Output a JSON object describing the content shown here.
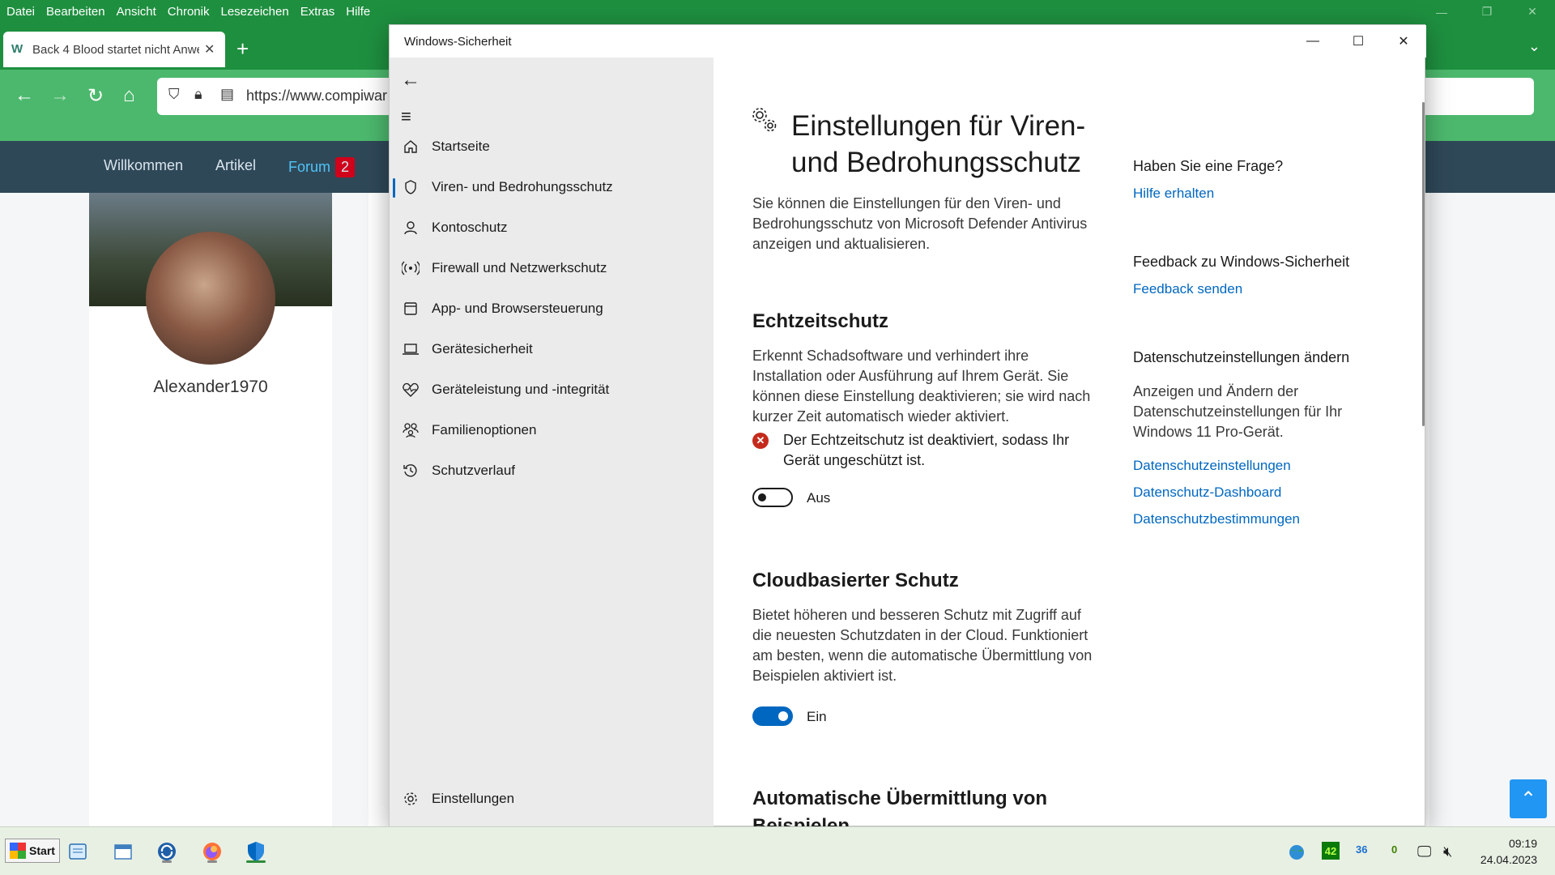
{
  "browser": {
    "menu": [
      "Datei",
      "Bearbeiten",
      "Ansicht",
      "Chronik",
      "Lesezeichen",
      "Extras",
      "Hilfe"
    ],
    "tab_title": "Back 4 Blood startet nicht Anwe",
    "url": "https://www.compiwar"
  },
  "site": {
    "nav": [
      "Willkommen",
      "Artikel",
      "Forum"
    ],
    "forum_badge": "2",
    "username": "Alexander1970"
  },
  "dialog": {
    "title": "Windows-Sicherheit",
    "sidebar": [
      {
        "label": "Startseite",
        "icon": "home-icon"
      },
      {
        "label": "Viren- und Bedrohungsschutz",
        "icon": "shield-icon"
      },
      {
        "label": "Kontoschutz",
        "icon": "person-icon"
      },
      {
        "label": "Firewall und Netzwerkschutz",
        "icon": "wireless-icon"
      },
      {
        "label": "App- und Browsersteuerung",
        "icon": "app-window-icon"
      },
      {
        "label": "Gerätesicherheit",
        "icon": "laptop-icon"
      },
      {
        "label": "Geräteleistung und -integrität",
        "icon": "heart-pulse-icon"
      },
      {
        "label": "Familienoptionen",
        "icon": "family-icon"
      },
      {
        "label": "Schutzverlauf",
        "icon": "history-icon"
      }
    ],
    "settings_label": "Einstellungen",
    "page_title": "Einstellungen für Viren- und Bedrohungsschutz",
    "page_desc": "Sie können die Einstellungen für den Viren- und Bedrohungsschutz von Microsoft Defender Antivirus anzeigen und aktualisieren.",
    "realtime": {
      "heading": "Echtzeitschutz",
      "desc": "Erkennt Schadsoftware und verhindert ihre Installation oder Ausführung auf Ihrem Gerät. Sie können diese Einstellung deaktivieren; sie wird nach kurzer Zeit automatisch wieder aktiviert.",
      "warning": "Der Echtzeitschutz ist deaktiviert, sodass Ihr Gerät ungeschützt ist.",
      "toggle_label": "Aus"
    },
    "cloud": {
      "heading": "Cloudbasierter Schutz",
      "desc": "Bietet höheren und besseren Schutz mit Zugriff auf die neuesten Schutzdaten in der Cloud. Funktioniert am besten, wenn die automatische Übermittlung von Beispielen aktiviert ist.",
      "toggle_label": "Ein"
    },
    "auto_submit": {
      "heading": "Automatische Übermittlung von Beispielen"
    },
    "aside": {
      "question_heading": "Haben Sie eine Frage?",
      "help_link": "Hilfe erhalten",
      "feedback_heading": "Feedback zu Windows-Sicherheit",
      "feedback_link": "Feedback senden",
      "privacy_heading": "Datenschutzeinstellungen ändern",
      "privacy_desc": "Anzeigen und Ändern der Datenschutzeinstellungen für Ihr Windows 11 Pro-Gerät.",
      "privacy_links": [
        "Datenschutzeinstellungen",
        "Datenschutz-Dashboard",
        "Datenschutzbestimmungen"
      ]
    }
  },
  "taskbar": {
    "start_label": "Start",
    "tray_values": [
      "42",
      "36",
      "0"
    ],
    "time": "09:19",
    "date": "24.04.2023"
  },
  "colors": {
    "firefox_green": "#1e8f3f",
    "accent_blue": "#0067c0",
    "error_red": "#c42b1c"
  }
}
